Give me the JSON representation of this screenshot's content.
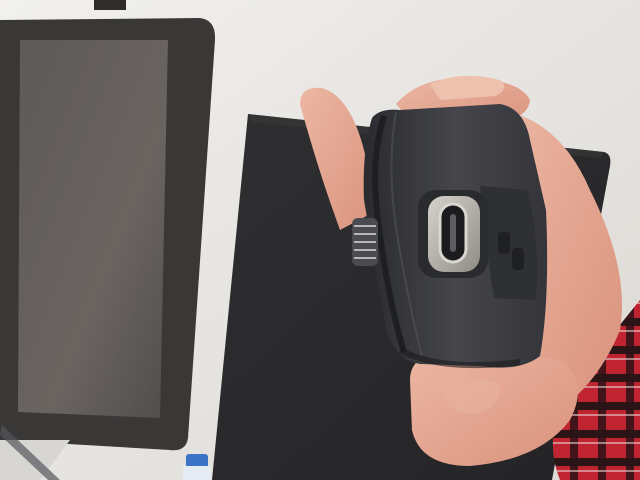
{
  "scene": {
    "subject": "usb-c-port-on-computer-mouse",
    "colors": {
      "background": "#e9e7e3",
      "monitor_bezel": "#3a3837",
      "monitor_screen": "#5a5654",
      "tablet": "#2b2a2b",
      "mouse_body": "#3a3b3f",
      "mouse_edge": "#1e1f22",
      "port_metal": "#b9b6ae",
      "skin": "#e3a894",
      "shirt_red": "#c02430",
      "shirt_dark": "#2a1416"
    }
  }
}
